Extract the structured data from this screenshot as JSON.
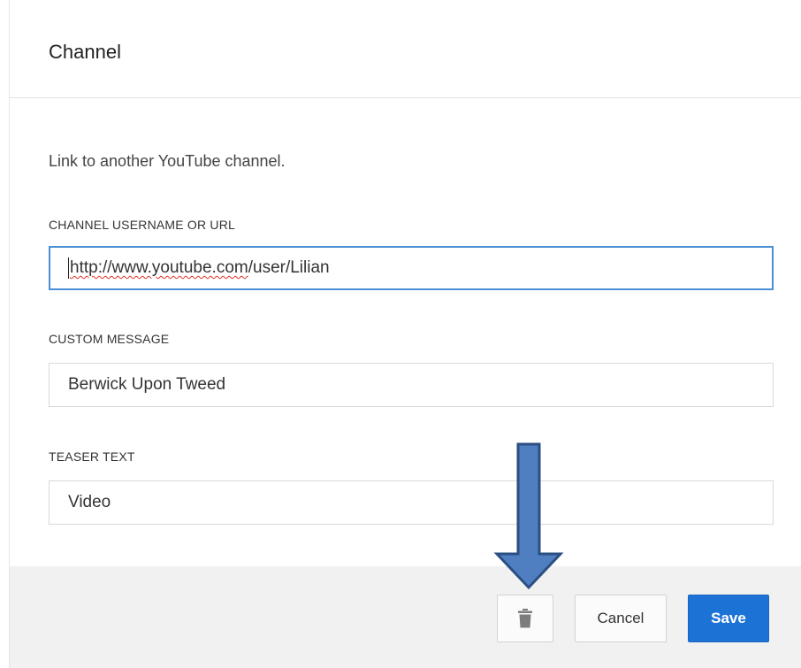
{
  "dialog": {
    "title": "Channel",
    "description": "Link to another YouTube channel."
  },
  "fields": {
    "channel_url": {
      "label": "CHANNEL USERNAME OR URL",
      "value_misspelled_part": "http://www.youtube.com",
      "value_rest": "/user/Lilian"
    },
    "custom_message": {
      "label": "CUSTOM MESSAGE",
      "value": "Berwick Upon Tweed"
    },
    "teaser_text": {
      "label": "TEASER TEXT",
      "value": "Video"
    }
  },
  "footer": {
    "delete_icon": "trash-icon",
    "cancel_label": "Cancel",
    "save_label": "Save"
  },
  "annotation": {
    "arrow_icon": "down-arrow-annotation",
    "arrow_color": "#4f7fc0"
  },
  "colors": {
    "save_button": "#1d72d6",
    "focus_border": "#4a8fd6",
    "footer_bg": "#f1f1f1"
  }
}
